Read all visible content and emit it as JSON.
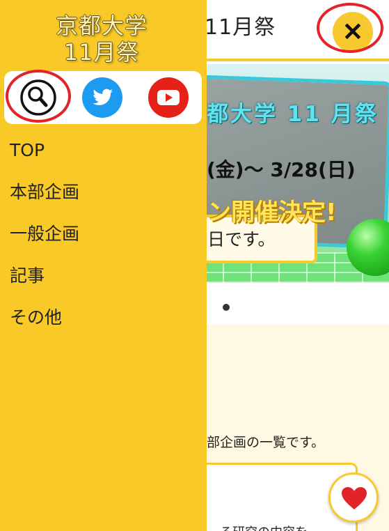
{
  "header": {
    "title": "11月祭",
    "close_icon": "close-icon"
  },
  "banner": {
    "line1": "都大学 11 月祭",
    "line2": "(金)〜 3/28(日)",
    "line3": "ン開催決定!",
    "caption": "日です。"
  },
  "content": {
    "intro": "部企画の一覧です。",
    "card_text": "る研究の内容を"
  },
  "drawer": {
    "logo_line1": "京都大学",
    "logo_line2": "11月祭",
    "social": [
      {
        "name": "search",
        "icon": "magnifier-icon"
      },
      {
        "name": "twitter",
        "icon": "twitter-bird-icon",
        "color": "#1d9bf0"
      },
      {
        "name": "youtube",
        "icon": "youtube-play-icon",
        "color": "#e62117"
      }
    ],
    "menu": [
      {
        "label": "TOP"
      },
      {
        "label": "本部企画"
      },
      {
        "label": "一般企画"
      },
      {
        "label": "記事"
      },
      {
        "label": "その他"
      }
    ]
  },
  "favorite": {
    "icon": "heart-icon",
    "color": "#e2232a"
  },
  "colors": {
    "accent": "#f9c927",
    "highlight_ring": "#e2232a"
  }
}
